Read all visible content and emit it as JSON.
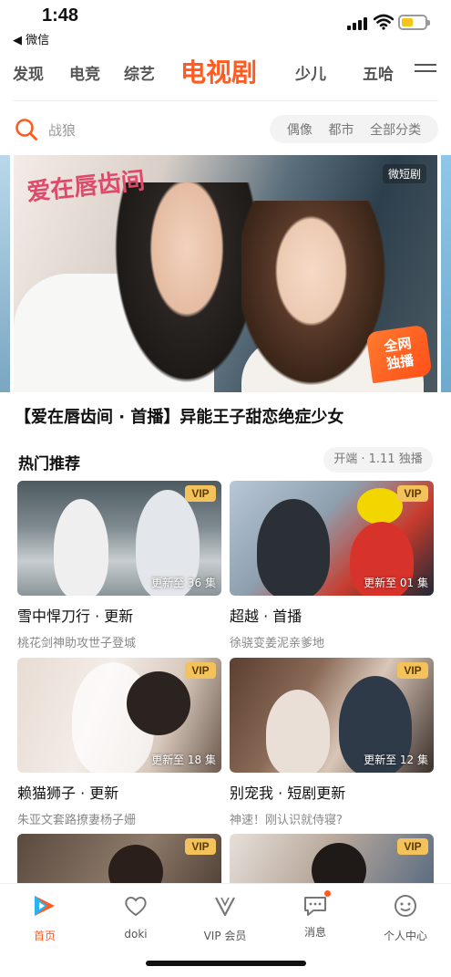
{
  "status_bar": {
    "time": "1:48",
    "back_app": "◀ 微信"
  },
  "tabs": [
    {
      "label": "发现"
    },
    {
      "label": "电竞"
    },
    {
      "label": "综艺"
    },
    {
      "label": "电视剧",
      "active": true
    },
    {
      "label": "少儿"
    },
    {
      "label": "五哈"
    }
  ],
  "search": {
    "placeholder": "战狼",
    "quick_links": [
      "偶像",
      "都市",
      "全部分类"
    ]
  },
  "banner": {
    "logo_text": "爱在唇齿间",
    "corner_mark": "微短剧",
    "badge": [
      "全网",
      "独播"
    ],
    "caption": "【爱在唇齿间 · 首播】异能王子甜恋绝症少女"
  },
  "section": {
    "title": "热门推荐",
    "pill": "开端 · 1.11 独播"
  },
  "cards": [
    {
      "vip": "VIP",
      "episode": "更新至 36 集",
      "title": "雪中悍刀行 · 更新",
      "subtitle": "桃花剑神助攻世子登城"
    },
    {
      "vip": "VIP",
      "episode": "更新至 01 集",
      "title": "超越 · 首播",
      "subtitle": "徐骁变姜泥亲爹地"
    },
    {
      "vip": "VIP",
      "episode": "更新至 18 集",
      "title": "赖猫狮子 · 更新",
      "subtitle": "朱亚文套路撩妻杨子姗"
    },
    {
      "vip": "VIP",
      "episode": "更新至 12 集",
      "title": "别宠我 · 短剧更新",
      "subtitle": "神速！刚认识就侍寝?"
    },
    {
      "vip": "VIP",
      "episode": "",
      "title": "",
      "subtitle": ""
    },
    {
      "vip": "VIP",
      "episode": "",
      "title": "",
      "subtitle": ""
    }
  ],
  "bottom_nav": [
    {
      "label": "首页",
      "icon": "play-logo-icon",
      "active": true
    },
    {
      "label": "doki",
      "icon": "doki-heart-icon"
    },
    {
      "label": "VIP 会员",
      "icon": "vip-v-icon"
    },
    {
      "label": "消息",
      "icon": "message-icon",
      "badge_dot": true
    },
    {
      "label": "个人中心",
      "icon": "smiley-icon"
    }
  ],
  "colors": {
    "accent": "#ff5a1f",
    "vip_badge": "#f4c25a"
  }
}
